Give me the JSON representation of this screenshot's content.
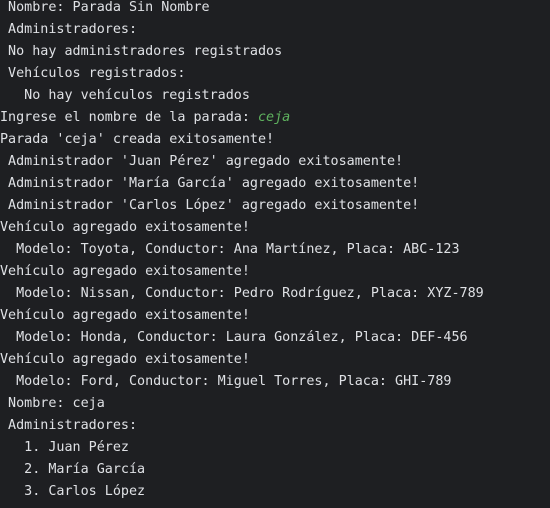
{
  "console": {
    "lines": [
      " Nombre: Parada Sin Nombre",
      " Administradores:",
      " No hay administradores registrados",
      " Vehículos registrados:",
      "   No hay vehículos registrados",
      "Ingrese el nombre de la parada: ",
      "Parada 'ceja' creada exitosamente!",
      " Administrador 'Juan Pérez' agregado exitosamente!",
      " Administrador 'María García' agregado exitosamente!",
      " Administrador 'Carlos López' agregado exitosamente!",
      "Vehículo agregado exitosamente!",
      "  Modelo: Toyota, Conductor: Ana Martínez, Placa: ABC-123",
      "Vehículo agregado exitosamente!",
      "  Modelo: Nissan, Conductor: Pedro Rodríguez, Placa: XYZ-789",
      "Vehículo agregado exitosamente!",
      "  Modelo: Honda, Conductor: Laura González, Placa: DEF-456",
      "Vehículo agregado exitosamente!",
      "  Modelo: Ford, Conductor: Miguel Torres, Placa: GHI-789",
      " Nombre: ceja",
      " Administradores:",
      "   1. Juan Pérez",
      "   2. María García",
      "   3. Carlos López"
    ],
    "user_input": "ceja",
    "colors": {
      "background": "#1e1f22",
      "text": "#dfe1e5",
      "input": "#5fb35f"
    }
  }
}
